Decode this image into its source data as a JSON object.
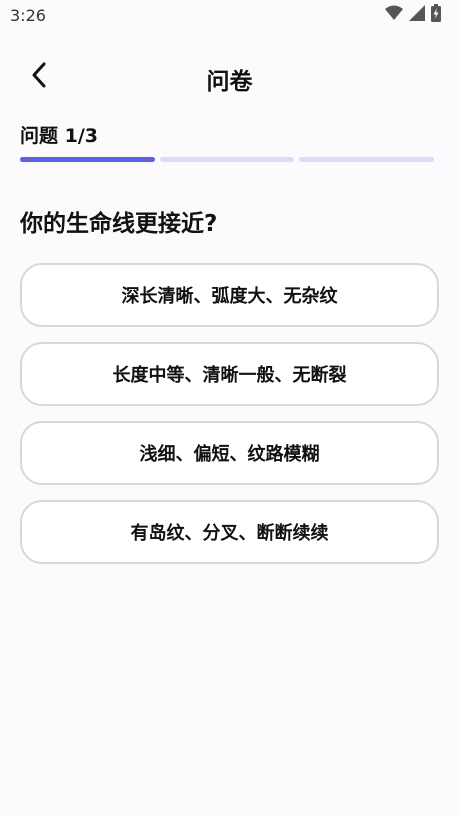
{
  "status_bar": {
    "time": "3:26",
    "icons": [
      "wifi-icon",
      "cellular-signal-icon",
      "battery-charging-icon"
    ]
  },
  "header": {
    "back_icon": "chevron-left-icon",
    "title": "问卷"
  },
  "quiz": {
    "counter": "问题 1/3",
    "progress": {
      "current": 1,
      "total": 3
    },
    "question": "你的生命线更接近?",
    "options": [
      {
        "label": "深长清晰、弧度大、无杂纹"
      },
      {
        "label": "长度中等、清晰一般、无断裂"
      },
      {
        "label": "浅细、偏短、纹路模糊"
      },
      {
        "label": "有岛纹、分叉、断断续续"
      }
    ]
  },
  "colors": {
    "accent": "#5b5fe9",
    "progress_inactive": "#dcdcf7",
    "option_border": "#d8d8d8",
    "background": "#fbfafc"
  }
}
